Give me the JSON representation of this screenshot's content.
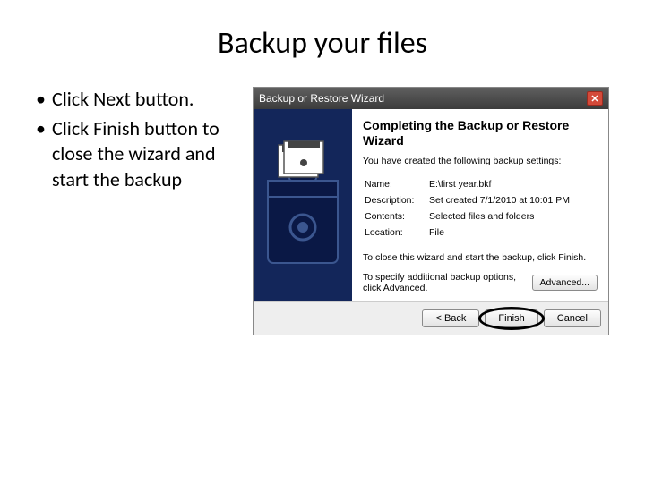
{
  "title": "Backup your files",
  "bullets": [
    "Click Next button.",
    "Click Finish button to close the wizard and start the backup"
  ],
  "wizard": {
    "titlebar": "Backup or Restore Wizard",
    "heading": "Completing the Backup or Restore Wizard",
    "intro": "You have created the following backup settings:",
    "rows": {
      "name_label": "Name:",
      "name_value": "E:\\first year.bkf",
      "desc_label": "Description:",
      "desc_value": "Set created 7/1/2010 at 10:01 PM",
      "contents_label": "Contents:",
      "contents_value": "Selected files and folders",
      "location_label": "Location:",
      "location_value": "File"
    },
    "finish_text": "To close this wizard and start the backup, click Finish.",
    "adv_text": "To specify additional backup options, click Advanced.",
    "adv_button": "Advanced...",
    "back_button": "< Back",
    "finish_button": "Finish",
    "cancel_button": "Cancel"
  }
}
